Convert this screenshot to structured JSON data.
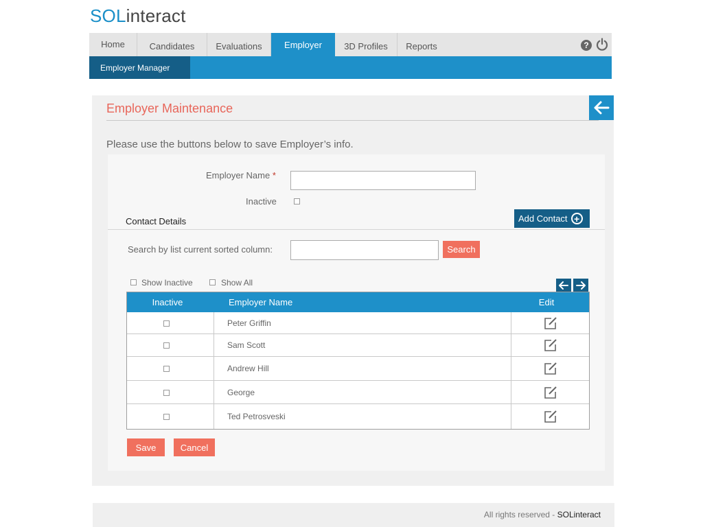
{
  "brand": {
    "sol": "SOL",
    "interact": "interact"
  },
  "nav": {
    "tabs": [
      {
        "label": "Home"
      },
      {
        "label": "Candidates"
      },
      {
        "label": "Evaluations"
      },
      {
        "label": "Employer",
        "active": true
      },
      {
        "label": "3D Profiles"
      },
      {
        "label": "Reports"
      }
    ],
    "help_glyph": "?",
    "icons": [
      "help-icon",
      "power-icon"
    ]
  },
  "subnav": {
    "active": "Employer Manager"
  },
  "panel": {
    "title": "Employer Maintenance",
    "back_icon": "arrow-left-icon",
    "intro": "Please use the buttons below to save Employer’s info."
  },
  "form": {
    "employer_name_label": "Employer Name",
    "required_mark": "*",
    "employer_name_value": "",
    "inactive_label": "Inactive",
    "inactive_checked": false
  },
  "contacts": {
    "title": "Contact Details",
    "add_button": "Add Contact",
    "add_glyph": "+",
    "search_label": "Search by list current sorted column:",
    "search_value": "",
    "search_button": "Search",
    "show_inactive": "Show Inactive",
    "show_all": "Show All",
    "columns": [
      "Inactive",
      "Employer Name",
      "Edit"
    ],
    "rows": [
      {
        "name": "Peter Griffin",
        "inactive": false
      },
      {
        "name": "Sam Scott",
        "inactive": false
      },
      {
        "name": "Andrew Hill",
        "inactive": false
      },
      {
        "name": "George",
        "inactive": false
      },
      {
        "name": "Ted Petrosveski",
        "inactive": false
      }
    ]
  },
  "actions": {
    "save": "Save",
    "cancel": "Cancel"
  },
  "footer": {
    "text": "All rights reserved - ",
    "brand": "SOLinteract"
  },
  "colors": {
    "primary": "#1e90c9",
    "dark": "#155e87",
    "accent": "#f0705e",
    "title": "#e8665a"
  }
}
